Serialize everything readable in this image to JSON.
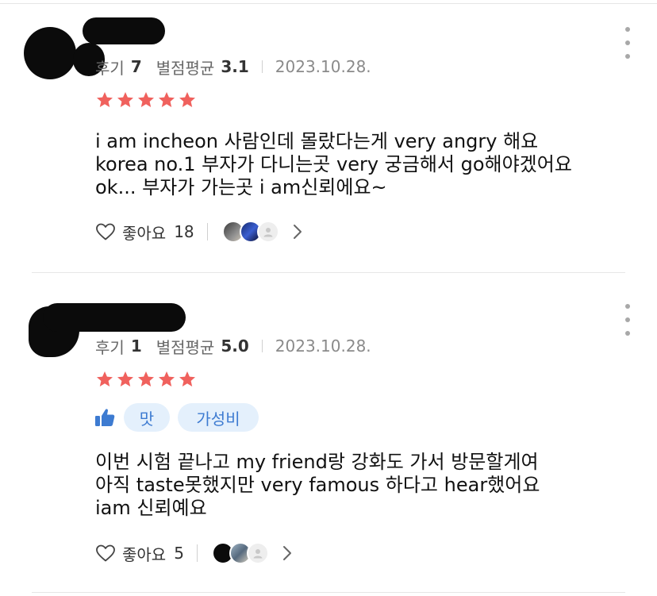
{
  "reviews": [
    {
      "review_count_label": "후기",
      "review_count": "7",
      "avg_rating_label": "별점평균",
      "avg_rating": "3.1",
      "date": "2023.10.28.",
      "rating_stars": 5,
      "body_lines": [
        "i am incheon 사람인데 몰랐다는게 very angry 해요",
        "korea no.1 부자가 다니는곳 very 궁금해서 go해야겠어요",
        "ok... 부자가 가는곳 i am신뢰에요~"
      ],
      "like_label": "좋아요",
      "like_count": "18",
      "tags": []
    },
    {
      "review_count_label": "후기",
      "review_count": "1",
      "avg_rating_label": "별점평균",
      "avg_rating": "5.0",
      "date": "2023.10.28.",
      "rating_stars": 5,
      "body_lines": [
        "이번 시험 끝나고 my friend랑 강화도 가서 방문할게여",
        "아직 taste못했지만 very famous 하다고 hear했어요",
        "iam 신뢰예요"
      ],
      "like_label": "좋아요",
      "like_count": "5",
      "tags": [
        "맛",
        "가성비"
      ]
    }
  ],
  "colors": {
    "star": "#f0615d",
    "tag_bg": "#e4f0fc",
    "tag_text": "#3d7bd1",
    "thumb": "#3d7bd1"
  },
  "icons": {
    "more": "more-vertical-icon",
    "like": "heart-outline-icon",
    "chevron": "chevron-right-icon",
    "thumb": "thumbs-up-icon",
    "star": "star-icon"
  }
}
